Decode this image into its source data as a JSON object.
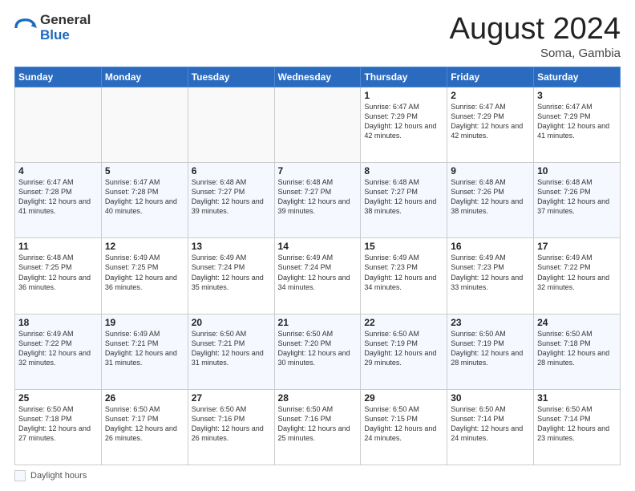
{
  "logo": {
    "general": "General",
    "blue": "Blue"
  },
  "title": {
    "month": "August 2024",
    "location": "Soma, Gambia"
  },
  "days_header": [
    "Sunday",
    "Monday",
    "Tuesday",
    "Wednesday",
    "Thursday",
    "Friday",
    "Saturday"
  ],
  "footer": {
    "label": "Daylight hours"
  },
  "weeks": [
    [
      {
        "day": "",
        "sunrise": "",
        "sunset": "",
        "daylight": "",
        "empty": true
      },
      {
        "day": "",
        "sunrise": "",
        "sunset": "",
        "daylight": "",
        "empty": true
      },
      {
        "day": "",
        "sunrise": "",
        "sunset": "",
        "daylight": "",
        "empty": true
      },
      {
        "day": "",
        "sunrise": "",
        "sunset": "",
        "daylight": "",
        "empty": true
      },
      {
        "day": "1",
        "sunrise": "Sunrise: 6:47 AM",
        "sunset": "Sunset: 7:29 PM",
        "daylight": "Daylight: 12 hours and 42 minutes."
      },
      {
        "day": "2",
        "sunrise": "Sunrise: 6:47 AM",
        "sunset": "Sunset: 7:29 PM",
        "daylight": "Daylight: 12 hours and 42 minutes."
      },
      {
        "day": "3",
        "sunrise": "Sunrise: 6:47 AM",
        "sunset": "Sunset: 7:29 PM",
        "daylight": "Daylight: 12 hours and 41 minutes."
      }
    ],
    [
      {
        "day": "4",
        "sunrise": "Sunrise: 6:47 AM",
        "sunset": "Sunset: 7:28 PM",
        "daylight": "Daylight: 12 hours and 41 minutes."
      },
      {
        "day": "5",
        "sunrise": "Sunrise: 6:47 AM",
        "sunset": "Sunset: 7:28 PM",
        "daylight": "Daylight: 12 hours and 40 minutes."
      },
      {
        "day": "6",
        "sunrise": "Sunrise: 6:48 AM",
        "sunset": "Sunset: 7:27 PM",
        "daylight": "Daylight: 12 hours and 39 minutes."
      },
      {
        "day": "7",
        "sunrise": "Sunrise: 6:48 AM",
        "sunset": "Sunset: 7:27 PM",
        "daylight": "Daylight: 12 hours and 39 minutes."
      },
      {
        "day": "8",
        "sunrise": "Sunrise: 6:48 AM",
        "sunset": "Sunset: 7:27 PM",
        "daylight": "Daylight: 12 hours and 38 minutes."
      },
      {
        "day": "9",
        "sunrise": "Sunrise: 6:48 AM",
        "sunset": "Sunset: 7:26 PM",
        "daylight": "Daylight: 12 hours and 38 minutes."
      },
      {
        "day": "10",
        "sunrise": "Sunrise: 6:48 AM",
        "sunset": "Sunset: 7:26 PM",
        "daylight": "Daylight: 12 hours and 37 minutes."
      }
    ],
    [
      {
        "day": "11",
        "sunrise": "Sunrise: 6:48 AM",
        "sunset": "Sunset: 7:25 PM",
        "daylight": "Daylight: 12 hours and 36 minutes."
      },
      {
        "day": "12",
        "sunrise": "Sunrise: 6:49 AM",
        "sunset": "Sunset: 7:25 PM",
        "daylight": "Daylight: 12 hours and 36 minutes."
      },
      {
        "day": "13",
        "sunrise": "Sunrise: 6:49 AM",
        "sunset": "Sunset: 7:24 PM",
        "daylight": "Daylight: 12 hours and 35 minutes."
      },
      {
        "day": "14",
        "sunrise": "Sunrise: 6:49 AM",
        "sunset": "Sunset: 7:24 PM",
        "daylight": "Daylight: 12 hours and 34 minutes."
      },
      {
        "day": "15",
        "sunrise": "Sunrise: 6:49 AM",
        "sunset": "Sunset: 7:23 PM",
        "daylight": "Daylight: 12 hours and 34 minutes."
      },
      {
        "day": "16",
        "sunrise": "Sunrise: 6:49 AM",
        "sunset": "Sunset: 7:23 PM",
        "daylight": "Daylight: 12 hours and 33 minutes."
      },
      {
        "day": "17",
        "sunrise": "Sunrise: 6:49 AM",
        "sunset": "Sunset: 7:22 PM",
        "daylight": "Daylight: 12 hours and 32 minutes."
      }
    ],
    [
      {
        "day": "18",
        "sunrise": "Sunrise: 6:49 AM",
        "sunset": "Sunset: 7:22 PM",
        "daylight": "Daylight: 12 hours and 32 minutes."
      },
      {
        "day": "19",
        "sunrise": "Sunrise: 6:49 AM",
        "sunset": "Sunset: 7:21 PM",
        "daylight": "Daylight: 12 hours and 31 minutes."
      },
      {
        "day": "20",
        "sunrise": "Sunrise: 6:50 AM",
        "sunset": "Sunset: 7:21 PM",
        "daylight": "Daylight: 12 hours and 31 minutes."
      },
      {
        "day": "21",
        "sunrise": "Sunrise: 6:50 AM",
        "sunset": "Sunset: 7:20 PM",
        "daylight": "Daylight: 12 hours and 30 minutes."
      },
      {
        "day": "22",
        "sunrise": "Sunrise: 6:50 AM",
        "sunset": "Sunset: 7:19 PM",
        "daylight": "Daylight: 12 hours and 29 minutes."
      },
      {
        "day": "23",
        "sunrise": "Sunrise: 6:50 AM",
        "sunset": "Sunset: 7:19 PM",
        "daylight": "Daylight: 12 hours and 28 minutes."
      },
      {
        "day": "24",
        "sunrise": "Sunrise: 6:50 AM",
        "sunset": "Sunset: 7:18 PM",
        "daylight": "Daylight: 12 hours and 28 minutes."
      }
    ],
    [
      {
        "day": "25",
        "sunrise": "Sunrise: 6:50 AM",
        "sunset": "Sunset: 7:18 PM",
        "daylight": "Daylight: 12 hours and 27 minutes."
      },
      {
        "day": "26",
        "sunrise": "Sunrise: 6:50 AM",
        "sunset": "Sunset: 7:17 PM",
        "daylight": "Daylight: 12 hours and 26 minutes."
      },
      {
        "day": "27",
        "sunrise": "Sunrise: 6:50 AM",
        "sunset": "Sunset: 7:16 PM",
        "daylight": "Daylight: 12 hours and 26 minutes."
      },
      {
        "day": "28",
        "sunrise": "Sunrise: 6:50 AM",
        "sunset": "Sunset: 7:16 PM",
        "daylight": "Daylight: 12 hours and 25 minutes."
      },
      {
        "day": "29",
        "sunrise": "Sunrise: 6:50 AM",
        "sunset": "Sunset: 7:15 PM",
        "daylight": "Daylight: 12 hours and 24 minutes."
      },
      {
        "day": "30",
        "sunrise": "Sunrise: 6:50 AM",
        "sunset": "Sunset: 7:14 PM",
        "daylight": "Daylight: 12 hours and 24 minutes."
      },
      {
        "day": "31",
        "sunrise": "Sunrise: 6:50 AM",
        "sunset": "Sunset: 7:14 PM",
        "daylight": "Daylight: 12 hours and 23 minutes."
      }
    ]
  ]
}
